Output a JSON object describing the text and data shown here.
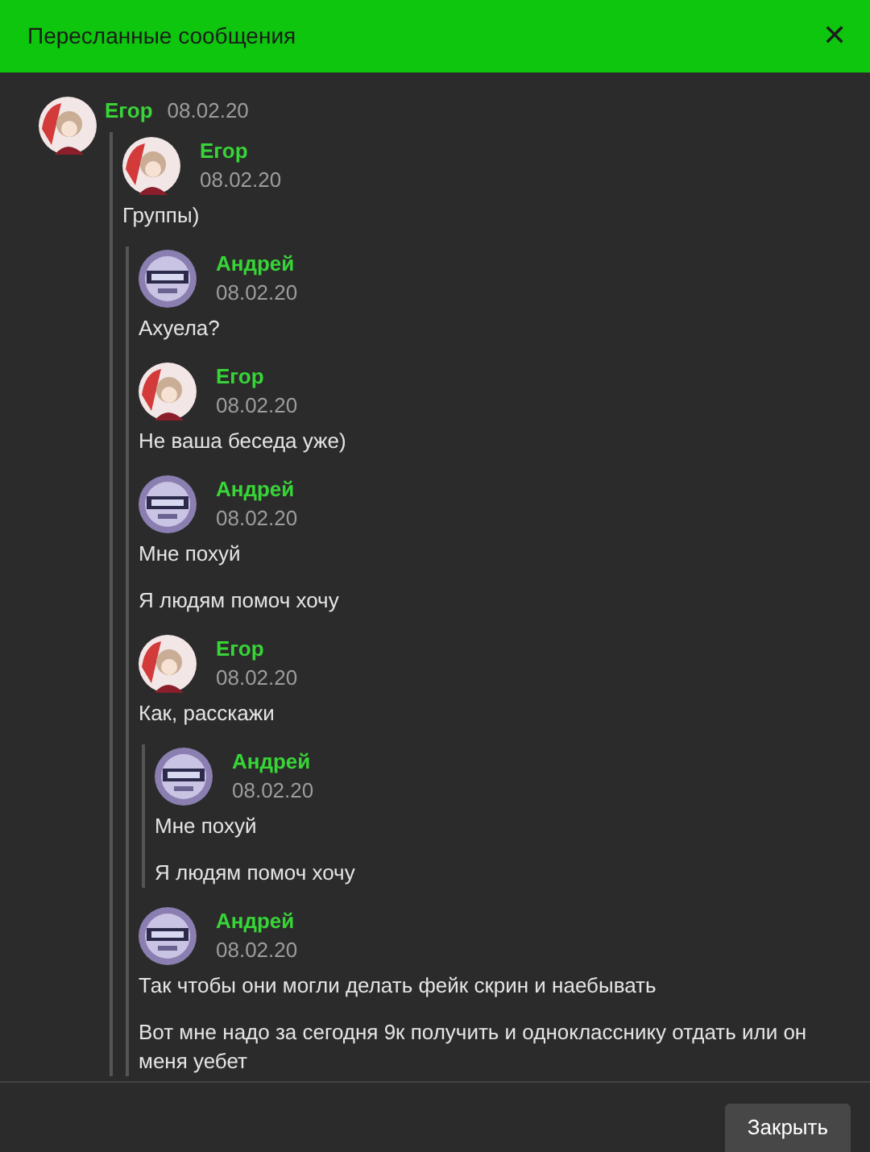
{
  "window": {
    "title": "Пересланные сообщения",
    "close": "✕"
  },
  "message": {
    "author": "Егор",
    "date": "08.02.20",
    "kind": "cat",
    "forwarded": [
      {
        "author": "Егор",
        "date": "08.02.20",
        "kind": "cat",
        "texts": [
          "Группы)"
        ],
        "forwarded": [
          {
            "author": "Андрей",
            "date": "08.02.20",
            "kind": "error",
            "texts": [
              "Ахуела?"
            ]
          },
          {
            "author": "Егор",
            "date": "08.02.20",
            "kind": "cat",
            "texts": [
              "Не ваша беседа уже)"
            ]
          },
          {
            "author": "Андрей",
            "date": "08.02.20",
            "kind": "error",
            "texts": [
              "Мне похуй",
              "Я людям помоч хочу"
            ]
          },
          {
            "author": "Егор",
            "date": "08.02.20",
            "kind": "cat",
            "texts": [
              "Как, расскажи"
            ],
            "forwarded": [
              {
                "author": "Андрей",
                "date": "08.02.20",
                "kind": "error",
                "texts": [
                  "Мне похуй",
                  "Я людям помоч хочу"
                ]
              }
            ]
          },
          {
            "author": "Андрей",
            "date": "08.02.20",
            "kind": "error",
            "texts": [
              "Так чтобы они могли делать фейк скрин и наебывать",
              "Вот мне надо за сегодня 9к получить и однокласснику отдать или он меня уебет"
            ]
          }
        ]
      }
    ]
  },
  "footer": {
    "button": "Закрыть"
  }
}
